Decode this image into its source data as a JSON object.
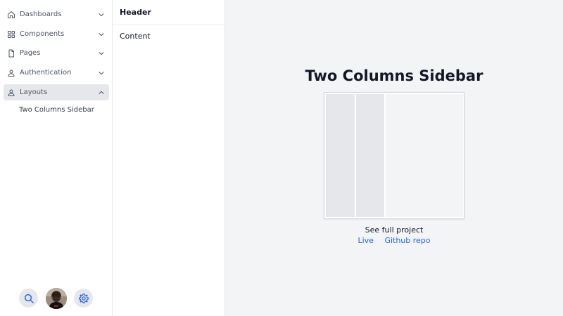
{
  "sidebar": {
    "items": [
      {
        "label": "Dashboards",
        "icon": "home-icon",
        "expanded": false
      },
      {
        "label": "Components",
        "icon": "grid-icon",
        "expanded": false
      },
      {
        "label": "Pages",
        "icon": "document-icon",
        "expanded": false
      },
      {
        "label": "Authentication",
        "icon": "user-icon",
        "expanded": false
      },
      {
        "label": "Layouts",
        "icon": "user-icon",
        "expanded": true
      }
    ],
    "sub_items": [
      {
        "label": "Two Columns Sidebar"
      }
    ],
    "footer": {
      "search_icon": "search-icon",
      "avatar": "avatar",
      "settings_icon": "gear-icon"
    }
  },
  "column2": {
    "header": "Header",
    "content": "Content"
  },
  "main": {
    "title": "Two Columns Sidebar",
    "see_full": "See full project",
    "links": {
      "live": "Live",
      "github": "Github repo"
    }
  },
  "colors": {
    "active_bg": "#e5e7eb",
    "link": "#2563eb",
    "page_bg": "#f3f4f6"
  }
}
